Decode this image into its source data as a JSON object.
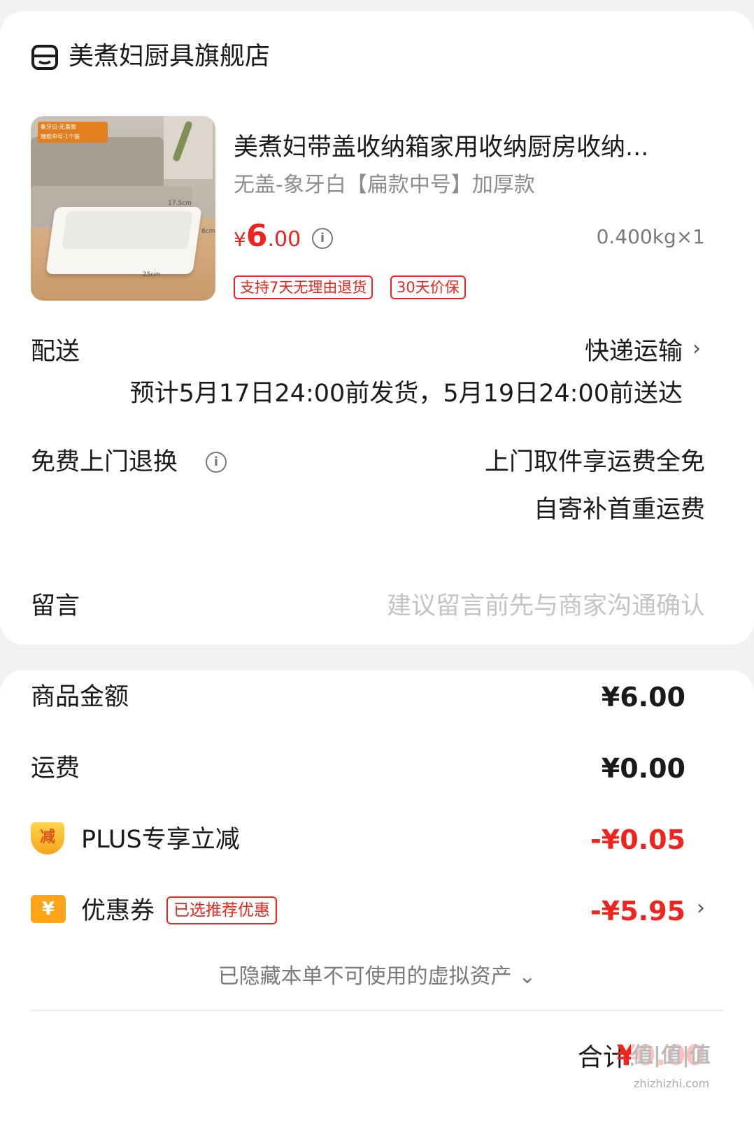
{
  "store": {
    "name": "美煮妇厨具旗舰店",
    "icon": "store-icon"
  },
  "product": {
    "title": "美煮妇带盖收纳箱家用收纳厨房收纳...",
    "variant": "无盖-象牙白【扁款中号】加厚款",
    "price_currency": "¥",
    "price_int": "6",
    "price_dec": ".00",
    "weight_qty": "0.400kg×1",
    "tags": [
      "支持7天无理由退货",
      "30天价保"
    ],
    "image_tag_line1": "象牙白-无盖款",
    "image_tag_line2": "矮款中号-1个装",
    "image_dims": [
      "17.5cm",
      "8cm",
      "25cm"
    ]
  },
  "delivery": {
    "label": "配送",
    "method": "快递运输",
    "estimate": "预计5月17日24:00前发货，5月19日24:00前送达"
  },
  "return_service": {
    "label": "免费上门退换",
    "line1": "上门取件享运费全免",
    "line2": "自寄补首重运费"
  },
  "message": {
    "label": "留言",
    "placeholder": "建议留言前先与商家沟通确认"
  },
  "summary": {
    "goods_label": "商品金额",
    "goods_value": "¥6.00",
    "shipping_label": "运费",
    "shipping_value": "¥0.00",
    "plus_badge": "减",
    "plus_label": "PLUS专享立减",
    "plus_value": "-¥0.05",
    "coupon_badge": "¥",
    "coupon_label": "优惠券",
    "coupon_tag": "已选推荐优惠",
    "coupon_value": "-¥5.95",
    "hidden_assets": "已隐藏本单不可使用的虚拟资产 ⌄"
  },
  "total": {
    "label": "合计:",
    "value": "¥0.00"
  },
  "watermark": {
    "text": "值|值|值",
    "sub": "zhizhizhi.com"
  },
  "colors": {
    "accent_red": "#f0241c",
    "coupon_orange": "#ffa416",
    "text": "#1a1a1a",
    "muted": "#8c8c8c"
  }
}
